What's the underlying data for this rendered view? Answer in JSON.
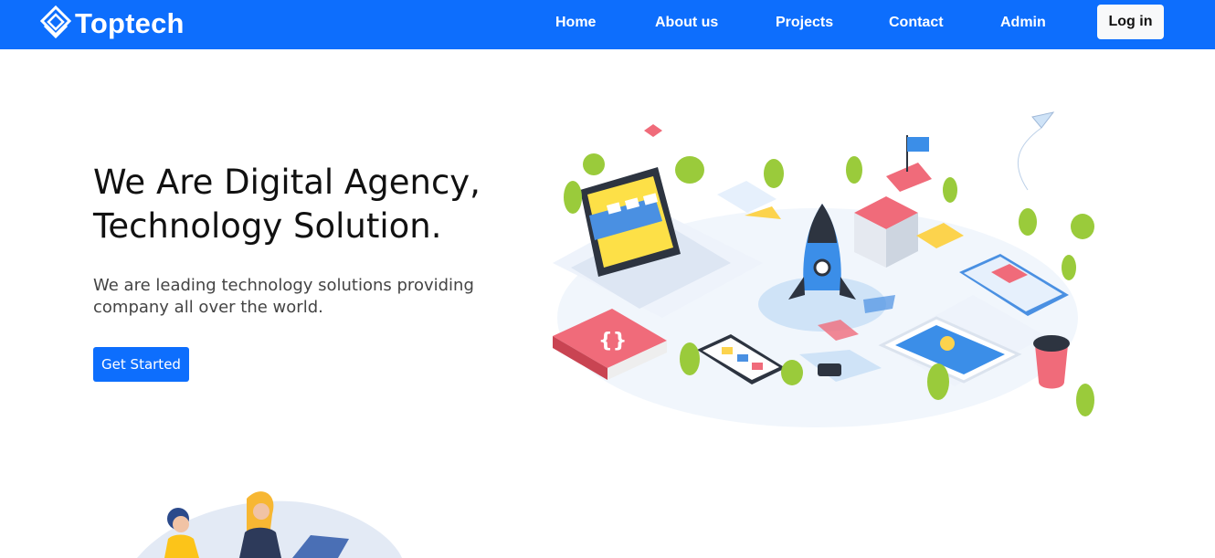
{
  "brand": {
    "name": "Toptech"
  },
  "nav": {
    "items": [
      {
        "label": "Home"
      },
      {
        "label": "About us"
      },
      {
        "label": "Projects"
      },
      {
        "label": "Contact"
      },
      {
        "label": "Admin"
      }
    ],
    "login_label": "Log in"
  },
  "hero": {
    "title_line1": "We Are Digital Agency,",
    "title_line2": "Technology Solution.",
    "subtitle_line1": "We are leading technology solutions providing",
    "subtitle_line2": "company all over the world.",
    "cta_label": "Get Started"
  },
  "colors": {
    "primary": "#0d6efd",
    "login_bg": "#f8f9fa"
  },
  "icons": {
    "logo": "diamond-logo-icon"
  }
}
